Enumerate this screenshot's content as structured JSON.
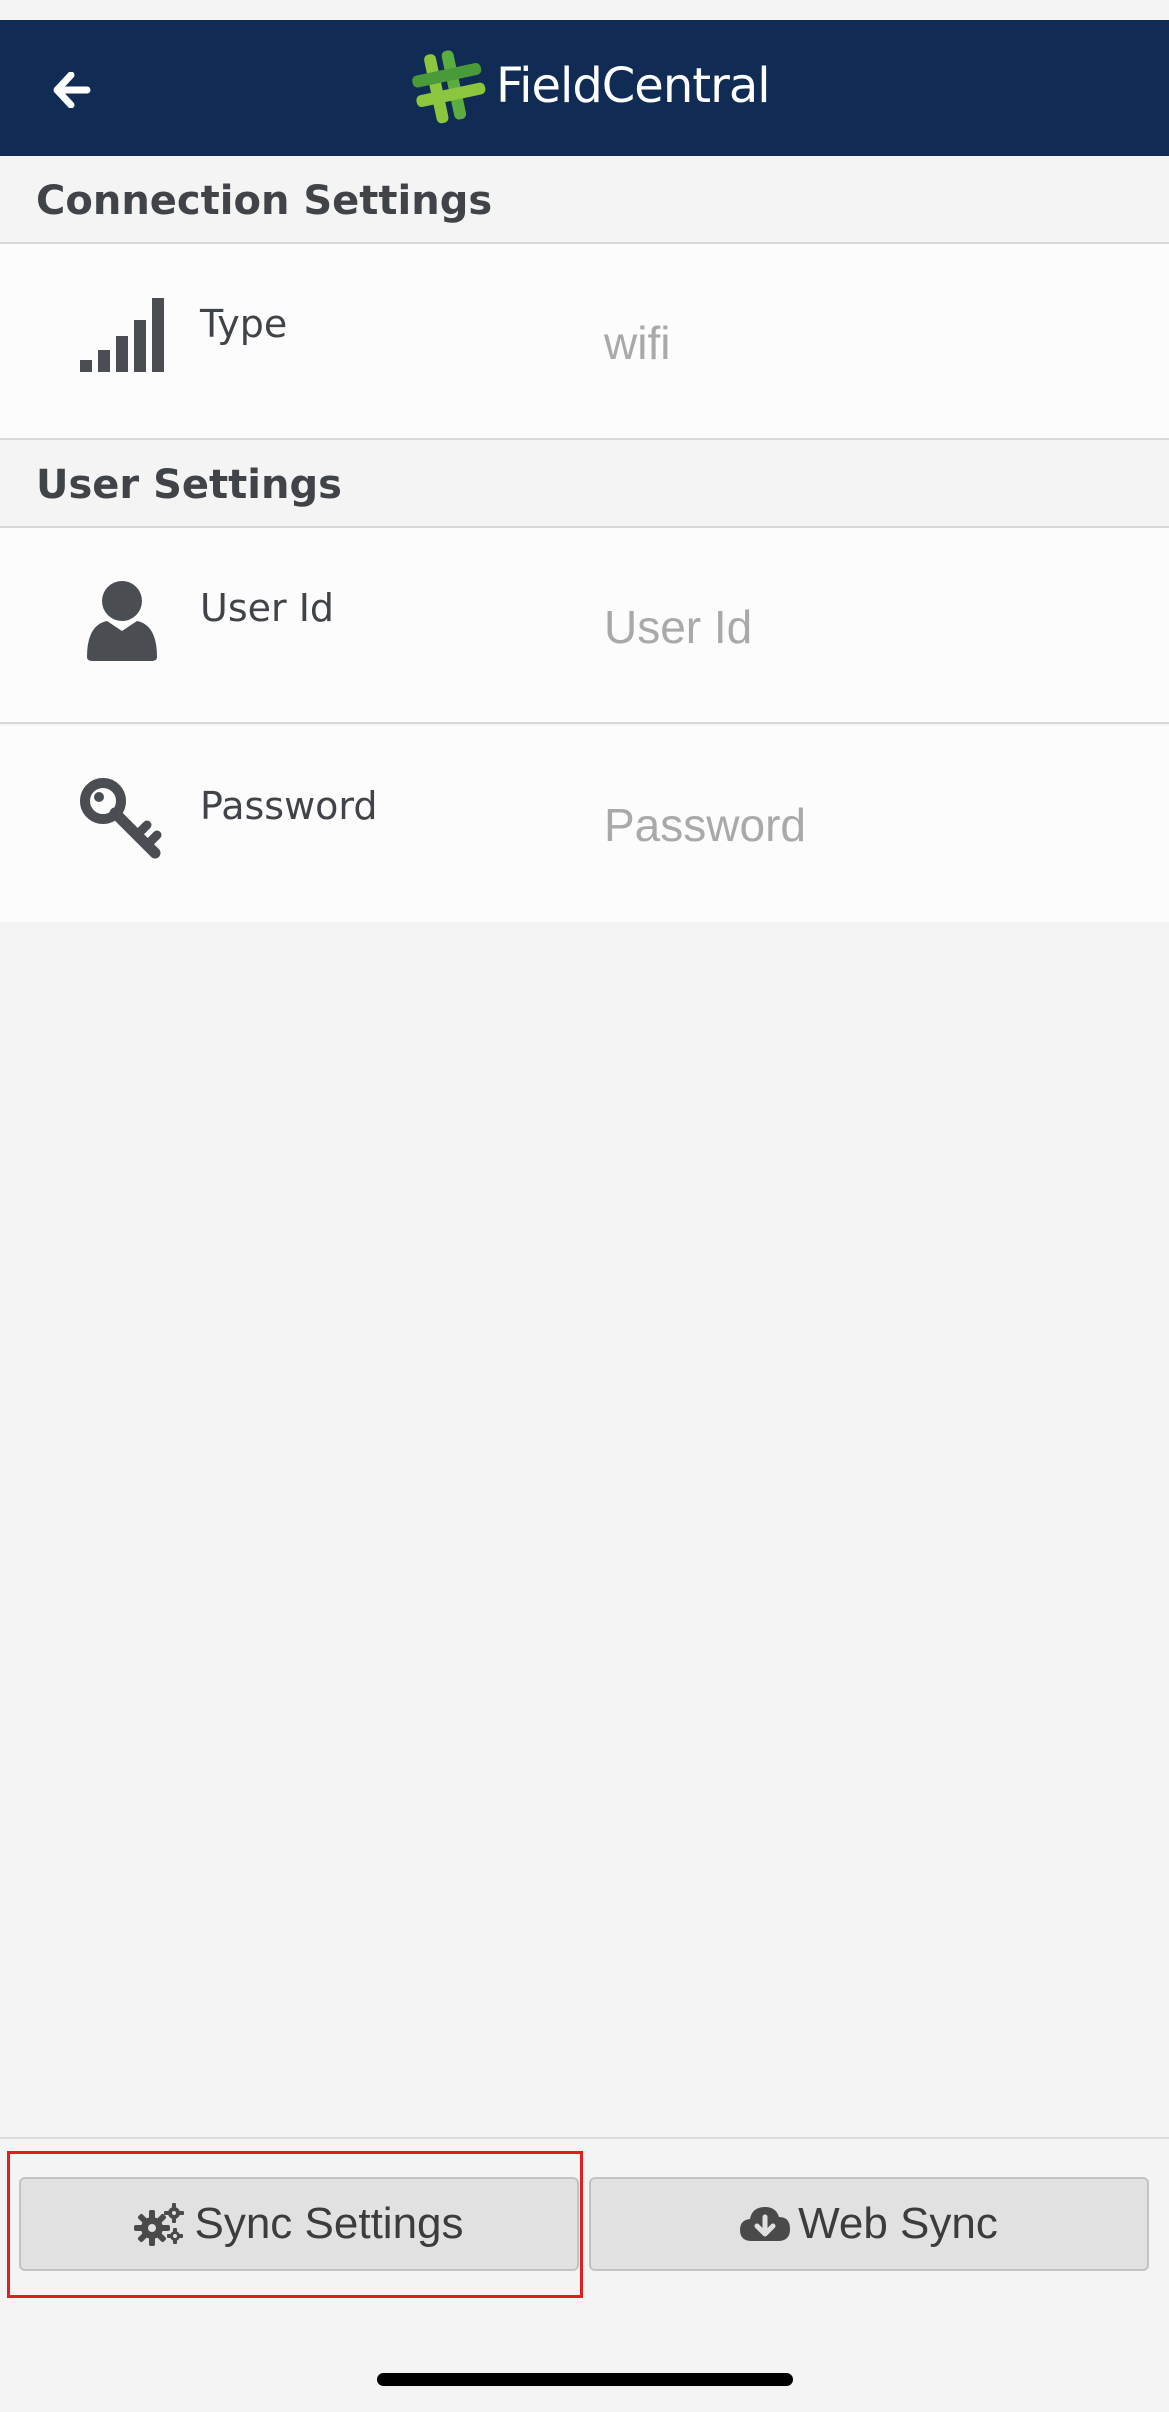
{
  "header": {
    "brand": "FieldCentral",
    "brand_colors": {
      "bar": "#102c54",
      "logo_light": "#8cc63f",
      "logo_dark": "#4a9a3a"
    }
  },
  "sections": {
    "connection": {
      "title": "Connection Settings",
      "rows": [
        {
          "label": "Type",
          "value": "wifi",
          "icon": "signal-bars-icon"
        }
      ]
    },
    "user": {
      "title": "User Settings",
      "rows": [
        {
          "label": "User Id",
          "placeholder": "User Id",
          "icon": "user-icon"
        },
        {
          "label": "Password",
          "placeholder": "Password",
          "icon": "key-icon"
        }
      ]
    }
  },
  "footer": {
    "sync_settings_label": "Sync Settings",
    "sync_settings_icon": "gears-icon",
    "web_sync_label": "Web Sync",
    "web_sync_icon": "cloud-download-icon",
    "highlight_color": "#e02020"
  }
}
